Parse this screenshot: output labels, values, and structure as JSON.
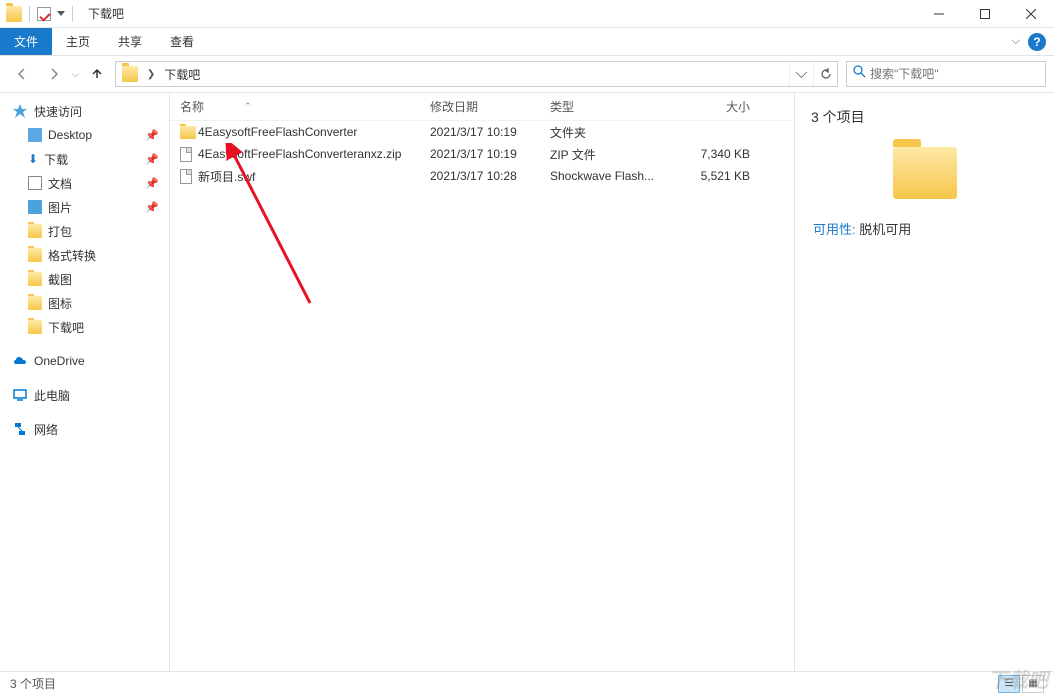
{
  "window": {
    "title": "下载吧"
  },
  "ribbon": {
    "file": "文件",
    "home": "主页",
    "share": "共享",
    "view": "查看"
  },
  "nav": {
    "breadcrumb": "下载吧",
    "search_placeholder": "搜索\"下载吧\""
  },
  "navpane": {
    "quick": "快速访问",
    "desktop": "Desktop",
    "downloads": "下载",
    "documents": "文档",
    "pictures": "图片",
    "dabao": "打包",
    "geshi": "格式转换",
    "jietu": "截图",
    "tubiao": "图标",
    "xiazaiba": "下载吧",
    "onedrive": "OneDrive",
    "thispc": "此电脑",
    "network": "网络"
  },
  "columns": {
    "name": "名称",
    "date": "修改日期",
    "type": "类型",
    "size": "大小"
  },
  "files": [
    {
      "icon": "folder",
      "name": "4EasysoftFreeFlashConverter",
      "date": "2021/3/17 10:19",
      "type": "文件夹",
      "size": ""
    },
    {
      "icon": "file",
      "name": "4EasysoftFreeFlashConverteranxz.zip",
      "date": "2021/3/17 10:19",
      "type": "ZIP 文件",
      "size": "7,340 KB"
    },
    {
      "icon": "file",
      "name": "新项目.swf",
      "date": "2021/3/17 10:28",
      "type": "Shockwave Flash...",
      "size": "5,521 KB"
    }
  ],
  "preview": {
    "count": "3 个项目",
    "avail_label": "可用性:",
    "avail_value": "脱机可用"
  },
  "status": {
    "text": "3 个项目"
  },
  "watermark": "下载吧"
}
